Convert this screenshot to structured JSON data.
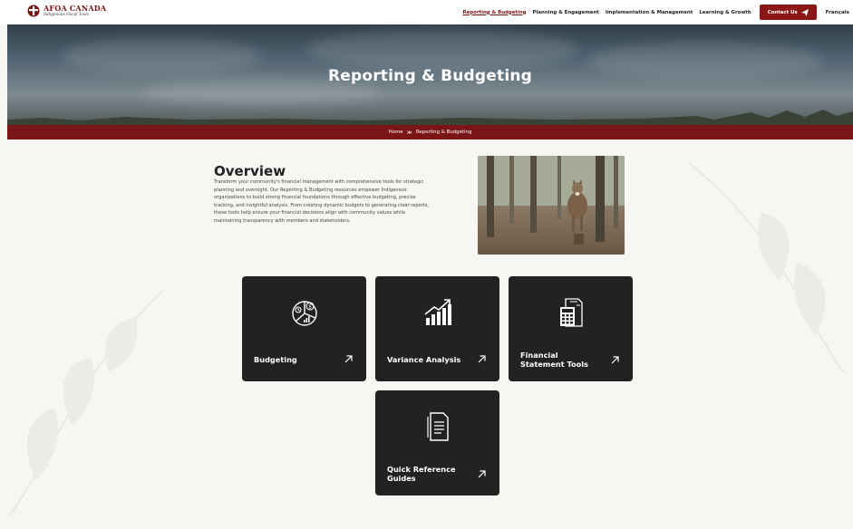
{
  "header": {
    "logo_title": "AFOA CANADA",
    "logo_subtitle": "Indigenous Fiscal Tools",
    "nav": [
      {
        "label": "Reporting & Budgeting",
        "active": true
      },
      {
        "label": "Planning & Engagement",
        "active": false
      },
      {
        "label": "Implementation & Management",
        "active": false
      },
      {
        "label": "Learning & Growth",
        "active": false
      }
    ],
    "contact_label": "Contact Us",
    "language_label": "Français"
  },
  "hero": {
    "title": "Reporting & Budgeting"
  },
  "breadcrumb": {
    "home": "Home",
    "separator": "≫",
    "current": "Reporting & Budgeting"
  },
  "overview": {
    "title": "Overview",
    "body": "Transform your community's financial management with comprehensive tools for strategic planning and oversight. Our Reporting & Budgeting resources empower Indigenous organizations to build strong financial foundations through effective budgeting, precise tracking, and insightful analysis. From creating dynamic budgets to generating clear reports, these tools help ensure your financial decisions align with community values while maintaining transparency with members and stakeholders."
  },
  "cards": [
    {
      "label": "Budgeting",
      "icon": "budget-chart-icon"
    },
    {
      "label": "Variance Analysis",
      "icon": "growth-chart-icon"
    },
    {
      "label": "Financial Statement Tools",
      "icon": "calculator-document-icon"
    },
    {
      "label": "Quick Reference Guides",
      "icon": "document-icon"
    }
  ],
  "colors": {
    "brand": "#7c1616",
    "card_bg": "#222222",
    "page_bg": "#f8f6f2"
  }
}
